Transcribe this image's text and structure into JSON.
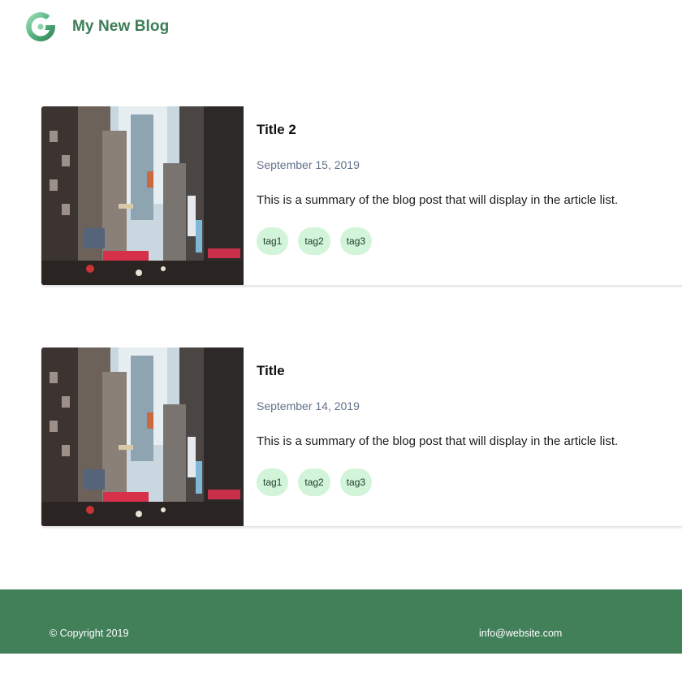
{
  "header": {
    "logo_icon": "g-logo-icon",
    "site_title": "My New Blog",
    "brand_color": "#3b7d55"
  },
  "articles": [
    {
      "title": "Title 2",
      "date": "September 15, 2019",
      "summary": "This is a summary of the blog post that will display in the article list.",
      "tags": [
        "tag1",
        "tag2",
        "tag3"
      ],
      "image": "city-street-photo"
    },
    {
      "title": "Title",
      "date": "September 14, 2019",
      "summary": "This is a summary of the blog post that will display in the article list.",
      "tags": [
        "tag1",
        "tag2",
        "tag3"
      ],
      "image": "city-street-photo"
    }
  ],
  "footer": {
    "copyright": "© Copyright 2019",
    "email": "info@website.com",
    "background_color": "#42805a"
  },
  "colors": {
    "tag_background": "#d2f4d8",
    "date_text": "#61718a"
  }
}
